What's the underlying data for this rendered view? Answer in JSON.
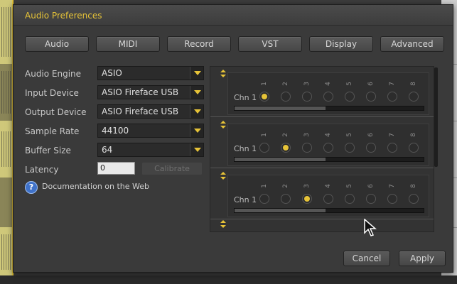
{
  "window": {
    "title": "Audio Preferences"
  },
  "tabs": [
    {
      "label": "Audio"
    },
    {
      "label": "MIDI"
    },
    {
      "label": "Record"
    },
    {
      "label": "VST"
    },
    {
      "label": "Display"
    },
    {
      "label": "Advanced"
    }
  ],
  "form": {
    "audio_engine": {
      "label": "Audio Engine",
      "value": "ASIO"
    },
    "input_device": {
      "label": "Input Device",
      "value": "ASIO Fireface USB"
    },
    "output_device": {
      "label": "Output Device",
      "value": "ASIO Fireface USB"
    },
    "sample_rate": {
      "label": "Sample Rate",
      "value": "44100"
    },
    "buffer_size": {
      "label": "Buffer Size",
      "value": "64"
    },
    "latency": {
      "label": "Latency",
      "value": "0",
      "calibrate_label": "Calibrate"
    }
  },
  "help": {
    "text": "Documentation on the Web",
    "icon": "question-icon"
  },
  "channels": {
    "numbers": [
      "1",
      "2",
      "3",
      "4",
      "5",
      "6",
      "7",
      "8"
    ],
    "groups": [
      {
        "label": "Chn 1",
        "selected": 1,
        "level": 0.48
      },
      {
        "label": "Chn 1",
        "selected": 2,
        "level": 0.48
      },
      {
        "label": "Chn 1",
        "selected": 3,
        "level": 0.48
      }
    ]
  },
  "footer": {
    "cancel_label": "Cancel",
    "apply_label": "Apply"
  },
  "colors": {
    "accent": "#e6c338",
    "dialog_bg": "#3a3a3a",
    "help_blue": "#3f72c9"
  }
}
